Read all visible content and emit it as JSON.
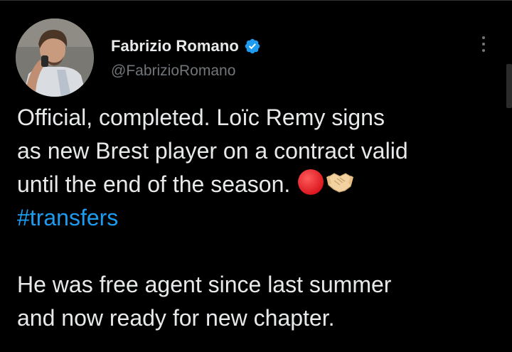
{
  "author": {
    "display_name": "Fabrizio Romano",
    "handle": "@FabrizioRomano",
    "verified": true
  },
  "tweet": {
    "lines": [
      "Official, completed. Loïc Remy signs",
      "as new Brest player on a contract valid",
      "until the end of the season."
    ],
    "emojis": [
      "red-circle-icon",
      "handshake-icon"
    ],
    "hashtag": "#transfers",
    "lines2": [
      "He was free agent since last summer",
      "and now ready for new chapter."
    ]
  },
  "colors": {
    "background": "#000000",
    "text": "#e7e9ea",
    "secondary": "#71767b",
    "link": "#1d9bf0",
    "verified": "#1d9bf0"
  }
}
